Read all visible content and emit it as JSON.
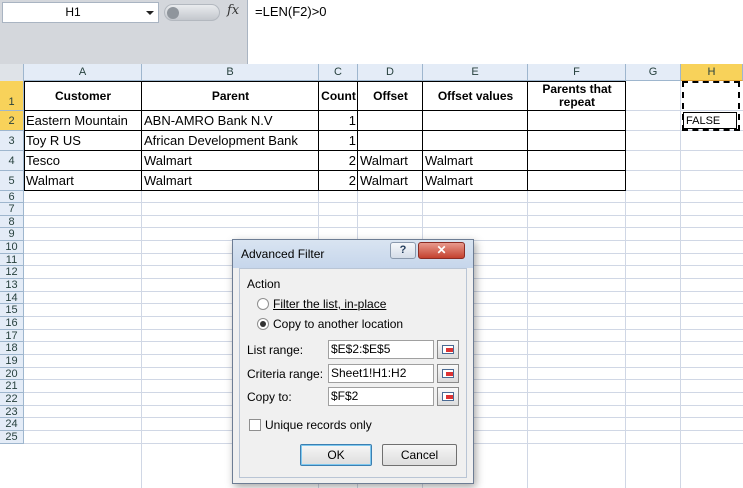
{
  "formula_bar": {
    "name_box": "H1",
    "formula": "=LEN(F2)>0",
    "fx_label": "fx"
  },
  "columns": [
    "A",
    "B",
    "C",
    "D",
    "E",
    "F",
    "G",
    "H"
  ],
  "rows": [
    "1",
    "2",
    "3",
    "4",
    "5",
    "6",
    "7",
    "8",
    "9",
    "10",
    "11",
    "12",
    "13",
    "14",
    "15",
    "16",
    "17",
    "18",
    "19",
    "20",
    "21",
    "22",
    "23",
    "24",
    "25"
  ],
  "table": {
    "headers": [
      "Customer",
      "Parent",
      "Count",
      "Offset",
      "Offset values",
      "Parents that repeat"
    ],
    "rows": [
      [
        "Eastern Mountain",
        "ABN-AMRO Bank N.V",
        "1",
        "",
        "",
        ""
      ],
      [
        "Toy R US",
        "African Development Bank",
        "1",
        "",
        "",
        ""
      ],
      [
        "Tesco",
        "Walmart",
        "2",
        "Walmart",
        "Walmart",
        ""
      ],
      [
        "Walmart",
        "Walmart",
        "2",
        "Walmart",
        "Walmart",
        ""
      ]
    ]
  },
  "h2_value": "FALSE",
  "dialog": {
    "title": "Advanced Filter",
    "help_label": "?",
    "close_label": "✕",
    "action_label": "Action",
    "radio_filter_inplace": "Filter the list, in-place",
    "radio_copy_location": "Copy to another location",
    "list_range_label": "List range:",
    "list_range_value": "$E$2:$E$5",
    "criteria_range_label": "Criteria range:",
    "criteria_range_value": "Sheet1!H1:H2",
    "copy_to_label": "Copy to:",
    "copy_to_value": "$F$2",
    "unique_records_label": "Unique records only",
    "ok_label": "OK",
    "cancel_label": "Cancel"
  },
  "colors": {
    "selected_header": "#f8d25a",
    "header_bg": "#e4ecf7",
    "close_button": "#c4412f"
  }
}
